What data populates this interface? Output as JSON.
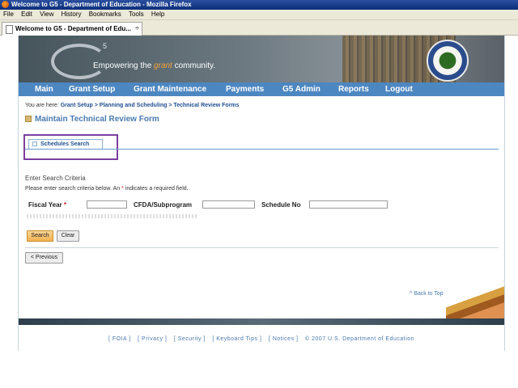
{
  "window": {
    "title": "Welcome to G5 - Department of Education - Mozilla Firefox"
  },
  "menu": [
    "File",
    "Edit",
    "View",
    "History",
    "Bookmarks",
    "Tools",
    "Help"
  ],
  "browser_tab": {
    "label": "Welcome to G5 - Department of Edu...",
    "close": "÷"
  },
  "banner": {
    "logo_sup": "5",
    "tagline_pre": "Empowering the ",
    "tagline_grant": "grant",
    "tagline_post": " community."
  },
  "nav": [
    "Main",
    "Grant Setup",
    "Grant Maintenance",
    "Payments",
    "G5 Admin",
    "Reports",
    "Logout"
  ],
  "breadcrumb": {
    "prefix": "You are here:",
    "path": "Grant Setup > Planning and Scheduling > Technical Review Forms"
  },
  "page_title": "Maintain Technical Review Form",
  "tab": "Schedules Search",
  "criteria_heading": "Enter Search Criteria",
  "help_text": {
    "pre": "Please enter search criteria below. An ",
    "star": "*",
    "post": " indicates a required field."
  },
  "fields": {
    "fiscal_year": {
      "label": "Fiscal Year",
      "required": "*",
      "value": ""
    },
    "cfda": {
      "label": "CFDA/Subprogram",
      "value": ""
    },
    "schedule_no": {
      "label": "Schedule No",
      "value": ""
    }
  },
  "buttons": {
    "search": "Search",
    "clear": "Clear",
    "previous": "< Previous"
  },
  "back_to_top": "^ Back to Top",
  "footer": {
    "links": [
      "[ FOIA ]",
      "[ Privacy ]",
      "[ Security ]",
      "[ Keyboard Tips ]",
      "[ Notices ]"
    ],
    "copyright": "© 2007 U.S. Department of Education"
  }
}
